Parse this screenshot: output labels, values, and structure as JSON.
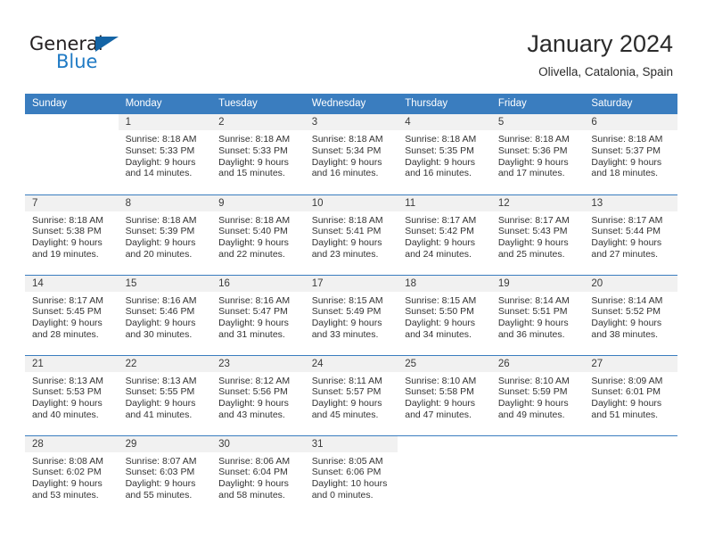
{
  "brand": {
    "name_part1": "General",
    "name_part2": "Blue",
    "triangle_icon": "triangle-icon"
  },
  "header": {
    "title": "January 2024",
    "subtitle": "Olivella, Catalonia, Spain"
  },
  "colors": {
    "header_blue": "#3a7dbf",
    "day_band_gray": "#f1f1f1",
    "logo_blue": "#1f7ac4",
    "text": "#333333"
  },
  "weekday_headers": [
    "Sunday",
    "Monday",
    "Tuesday",
    "Wednesday",
    "Thursday",
    "Friday",
    "Saturday"
  ],
  "labels": {
    "sunrise_prefix": "Sunrise:",
    "sunset_prefix": "Sunset:",
    "daylight_prefix": "Daylight:"
  },
  "weeks": [
    [
      {
        "day": "",
        "lines": []
      },
      {
        "day": "1",
        "lines": [
          "Sunrise: 8:18 AM",
          "Sunset: 5:33 PM",
          "Daylight: 9 hours",
          "and 14 minutes."
        ]
      },
      {
        "day": "2",
        "lines": [
          "Sunrise: 8:18 AM",
          "Sunset: 5:33 PM",
          "Daylight: 9 hours",
          "and 15 minutes."
        ]
      },
      {
        "day": "3",
        "lines": [
          "Sunrise: 8:18 AM",
          "Sunset: 5:34 PM",
          "Daylight: 9 hours",
          "and 16 minutes."
        ]
      },
      {
        "day": "4",
        "lines": [
          "Sunrise: 8:18 AM",
          "Sunset: 5:35 PM",
          "Daylight: 9 hours",
          "and 16 minutes."
        ]
      },
      {
        "day": "5",
        "lines": [
          "Sunrise: 8:18 AM",
          "Sunset: 5:36 PM",
          "Daylight: 9 hours",
          "and 17 minutes."
        ]
      },
      {
        "day": "6",
        "lines": [
          "Sunrise: 8:18 AM",
          "Sunset: 5:37 PM",
          "Daylight: 9 hours",
          "and 18 minutes."
        ]
      }
    ],
    [
      {
        "day": "7",
        "lines": [
          "Sunrise: 8:18 AM",
          "Sunset: 5:38 PM",
          "Daylight: 9 hours",
          "and 19 minutes."
        ]
      },
      {
        "day": "8",
        "lines": [
          "Sunrise: 8:18 AM",
          "Sunset: 5:39 PM",
          "Daylight: 9 hours",
          "and 20 minutes."
        ]
      },
      {
        "day": "9",
        "lines": [
          "Sunrise: 8:18 AM",
          "Sunset: 5:40 PM",
          "Daylight: 9 hours",
          "and 22 minutes."
        ]
      },
      {
        "day": "10",
        "lines": [
          "Sunrise: 8:18 AM",
          "Sunset: 5:41 PM",
          "Daylight: 9 hours",
          "and 23 minutes."
        ]
      },
      {
        "day": "11",
        "lines": [
          "Sunrise: 8:17 AM",
          "Sunset: 5:42 PM",
          "Daylight: 9 hours",
          "and 24 minutes."
        ]
      },
      {
        "day": "12",
        "lines": [
          "Sunrise: 8:17 AM",
          "Sunset: 5:43 PM",
          "Daylight: 9 hours",
          "and 25 minutes."
        ]
      },
      {
        "day": "13",
        "lines": [
          "Sunrise: 8:17 AM",
          "Sunset: 5:44 PM",
          "Daylight: 9 hours",
          "and 27 minutes."
        ]
      }
    ],
    [
      {
        "day": "14",
        "lines": [
          "Sunrise: 8:17 AM",
          "Sunset: 5:45 PM",
          "Daylight: 9 hours",
          "and 28 minutes."
        ]
      },
      {
        "day": "15",
        "lines": [
          "Sunrise: 8:16 AM",
          "Sunset: 5:46 PM",
          "Daylight: 9 hours",
          "and 30 minutes."
        ]
      },
      {
        "day": "16",
        "lines": [
          "Sunrise: 8:16 AM",
          "Sunset: 5:47 PM",
          "Daylight: 9 hours",
          "and 31 minutes."
        ]
      },
      {
        "day": "17",
        "lines": [
          "Sunrise: 8:15 AM",
          "Sunset: 5:49 PM",
          "Daylight: 9 hours",
          "and 33 minutes."
        ]
      },
      {
        "day": "18",
        "lines": [
          "Sunrise: 8:15 AM",
          "Sunset: 5:50 PM",
          "Daylight: 9 hours",
          "and 34 minutes."
        ]
      },
      {
        "day": "19",
        "lines": [
          "Sunrise: 8:14 AM",
          "Sunset: 5:51 PM",
          "Daylight: 9 hours",
          "and 36 minutes."
        ]
      },
      {
        "day": "20",
        "lines": [
          "Sunrise: 8:14 AM",
          "Sunset: 5:52 PM",
          "Daylight: 9 hours",
          "and 38 minutes."
        ]
      }
    ],
    [
      {
        "day": "21",
        "lines": [
          "Sunrise: 8:13 AM",
          "Sunset: 5:53 PM",
          "Daylight: 9 hours",
          "and 40 minutes."
        ]
      },
      {
        "day": "22",
        "lines": [
          "Sunrise: 8:13 AM",
          "Sunset: 5:55 PM",
          "Daylight: 9 hours",
          "and 41 minutes."
        ]
      },
      {
        "day": "23",
        "lines": [
          "Sunrise: 8:12 AM",
          "Sunset: 5:56 PM",
          "Daylight: 9 hours",
          "and 43 minutes."
        ]
      },
      {
        "day": "24",
        "lines": [
          "Sunrise: 8:11 AM",
          "Sunset: 5:57 PM",
          "Daylight: 9 hours",
          "and 45 minutes."
        ]
      },
      {
        "day": "25",
        "lines": [
          "Sunrise: 8:10 AM",
          "Sunset: 5:58 PM",
          "Daylight: 9 hours",
          "and 47 minutes."
        ]
      },
      {
        "day": "26",
        "lines": [
          "Sunrise: 8:10 AM",
          "Sunset: 5:59 PM",
          "Daylight: 9 hours",
          "and 49 minutes."
        ]
      },
      {
        "day": "27",
        "lines": [
          "Sunrise: 8:09 AM",
          "Sunset: 6:01 PM",
          "Daylight: 9 hours",
          "and 51 minutes."
        ]
      }
    ],
    [
      {
        "day": "28",
        "lines": [
          "Sunrise: 8:08 AM",
          "Sunset: 6:02 PM",
          "Daylight: 9 hours",
          "and 53 minutes."
        ]
      },
      {
        "day": "29",
        "lines": [
          "Sunrise: 8:07 AM",
          "Sunset: 6:03 PM",
          "Daylight: 9 hours",
          "and 55 minutes."
        ]
      },
      {
        "day": "30",
        "lines": [
          "Sunrise: 8:06 AM",
          "Sunset: 6:04 PM",
          "Daylight: 9 hours",
          "and 58 minutes."
        ]
      },
      {
        "day": "31",
        "lines": [
          "Sunrise: 8:05 AM",
          "Sunset: 6:06 PM",
          "Daylight: 10 hours",
          "and 0 minutes."
        ]
      },
      {
        "day": "",
        "lines": []
      },
      {
        "day": "",
        "lines": []
      },
      {
        "day": "",
        "lines": []
      }
    ]
  ]
}
